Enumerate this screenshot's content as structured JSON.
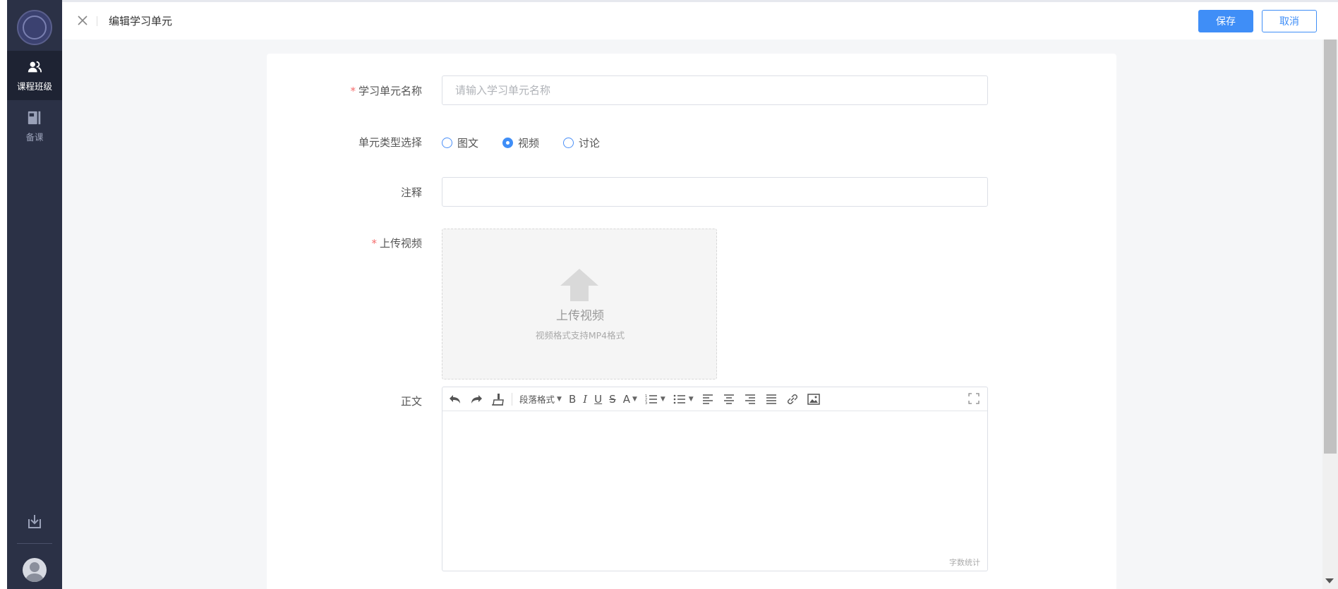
{
  "header": {
    "title": "编辑学习单元",
    "save_label": "保存",
    "cancel_label": "取消"
  },
  "sidebar": {
    "items": [
      {
        "label": "课程班级",
        "icon": "users-icon",
        "active": true
      },
      {
        "label": "备课",
        "icon": "book-icon",
        "active": false
      }
    ]
  },
  "form": {
    "name": {
      "label": "学习单元名称",
      "required": true,
      "placeholder": "请输入学习单元名称",
      "value": ""
    },
    "type": {
      "label": "单元类型选择",
      "options": [
        "图文",
        "视频",
        "讨论"
      ],
      "selected": "视频"
    },
    "note": {
      "label": "注释",
      "value": ""
    },
    "upload": {
      "label": "上传视频",
      "required": true,
      "title": "上传视频",
      "hint": "视频格式支持MP4格式"
    },
    "body": {
      "label": "正文",
      "paragraph_format": "段落格式",
      "word_count": "字数统计"
    }
  },
  "colors": {
    "accent": "#3f8ef7",
    "sidebar_bg": "#2b3146",
    "required": "#f56c6c"
  }
}
